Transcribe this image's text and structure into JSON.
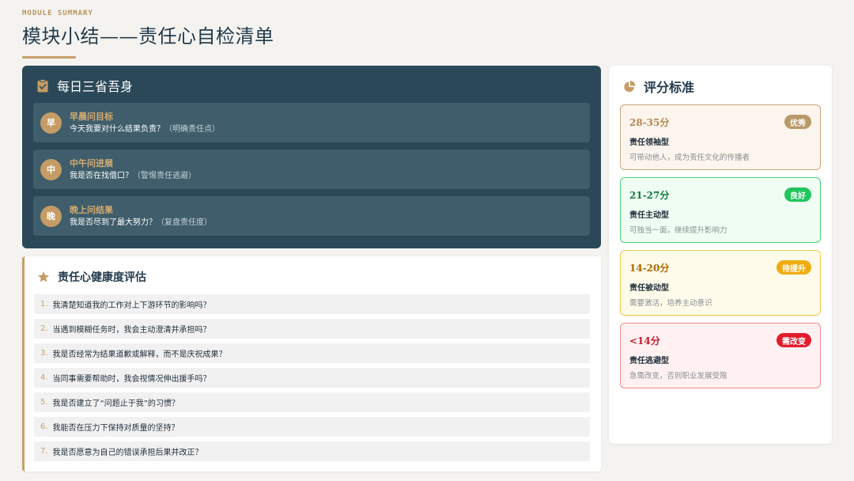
{
  "header": {
    "eyebrow": "MODULE SUMMARY",
    "title": "模块小结——责任心自检清单"
  },
  "daily": {
    "icon": "clipboard-check-icon",
    "title": "每日三省吾身",
    "items": [
      {
        "badge": "早",
        "title": "早晨问目标",
        "question": "今天我要对什么结果负责？",
        "hint": "（明确责任点）"
      },
      {
        "badge": "中",
        "title": "中午问进展",
        "question": "我是否在找借口？",
        "hint": "（警惕责任逃避）"
      },
      {
        "badge": "晚",
        "title": "晚上问结果",
        "question": "我是否尽到了最大努力？",
        "hint": "（复盘责任度）"
      }
    ]
  },
  "health": {
    "icon": "star-icon",
    "title": "责任心健康度评估",
    "questions": [
      {
        "num": "1.",
        "text": "我清楚知道我的工作对上下游环节的影响吗？"
      },
      {
        "num": "2.",
        "text": "当遇到模糊任务时，我会主动澄清并承担吗？"
      },
      {
        "num": "3.",
        "text": "我是否经常为结果道歉或解释，而不是庆祝成果？"
      },
      {
        "num": "4.",
        "text": "当同事需要帮助时，我会视情况伸出援手吗？"
      },
      {
        "num": "5.",
        "text": "我是否建立了“问题止于我”的习惯？"
      },
      {
        "num": "6.",
        "text": "我能否在压力下保持对质量的坚持？"
      },
      {
        "num": "7.",
        "text": "我是否愿意为自己的错误承担后果并改正？"
      }
    ]
  },
  "scoring": {
    "icon": "pie-chart-icon",
    "title": "评分标准",
    "tiers": [
      {
        "range": "28-35分",
        "badge": "优秀",
        "name": "责任领袖型",
        "desc": "可带动他人，成为责任文化的传播者",
        "color": "#b99968"
      },
      {
        "range": "21-27分",
        "badge": "良好",
        "name": "责任主动型",
        "desc": "可独当一面，继续提升影响力",
        "color": "#22c55e"
      },
      {
        "range": "14-20分",
        "badge": "待提升",
        "name": "责任被动型",
        "desc": "需要激活，培养主动意识",
        "color": "#efac12"
      },
      {
        "range": "<14分",
        "badge": "需改变",
        "name": "责任逃避型",
        "desc": "急需改变，否则职业发展受限",
        "color": "#e11d2e"
      }
    ]
  }
}
